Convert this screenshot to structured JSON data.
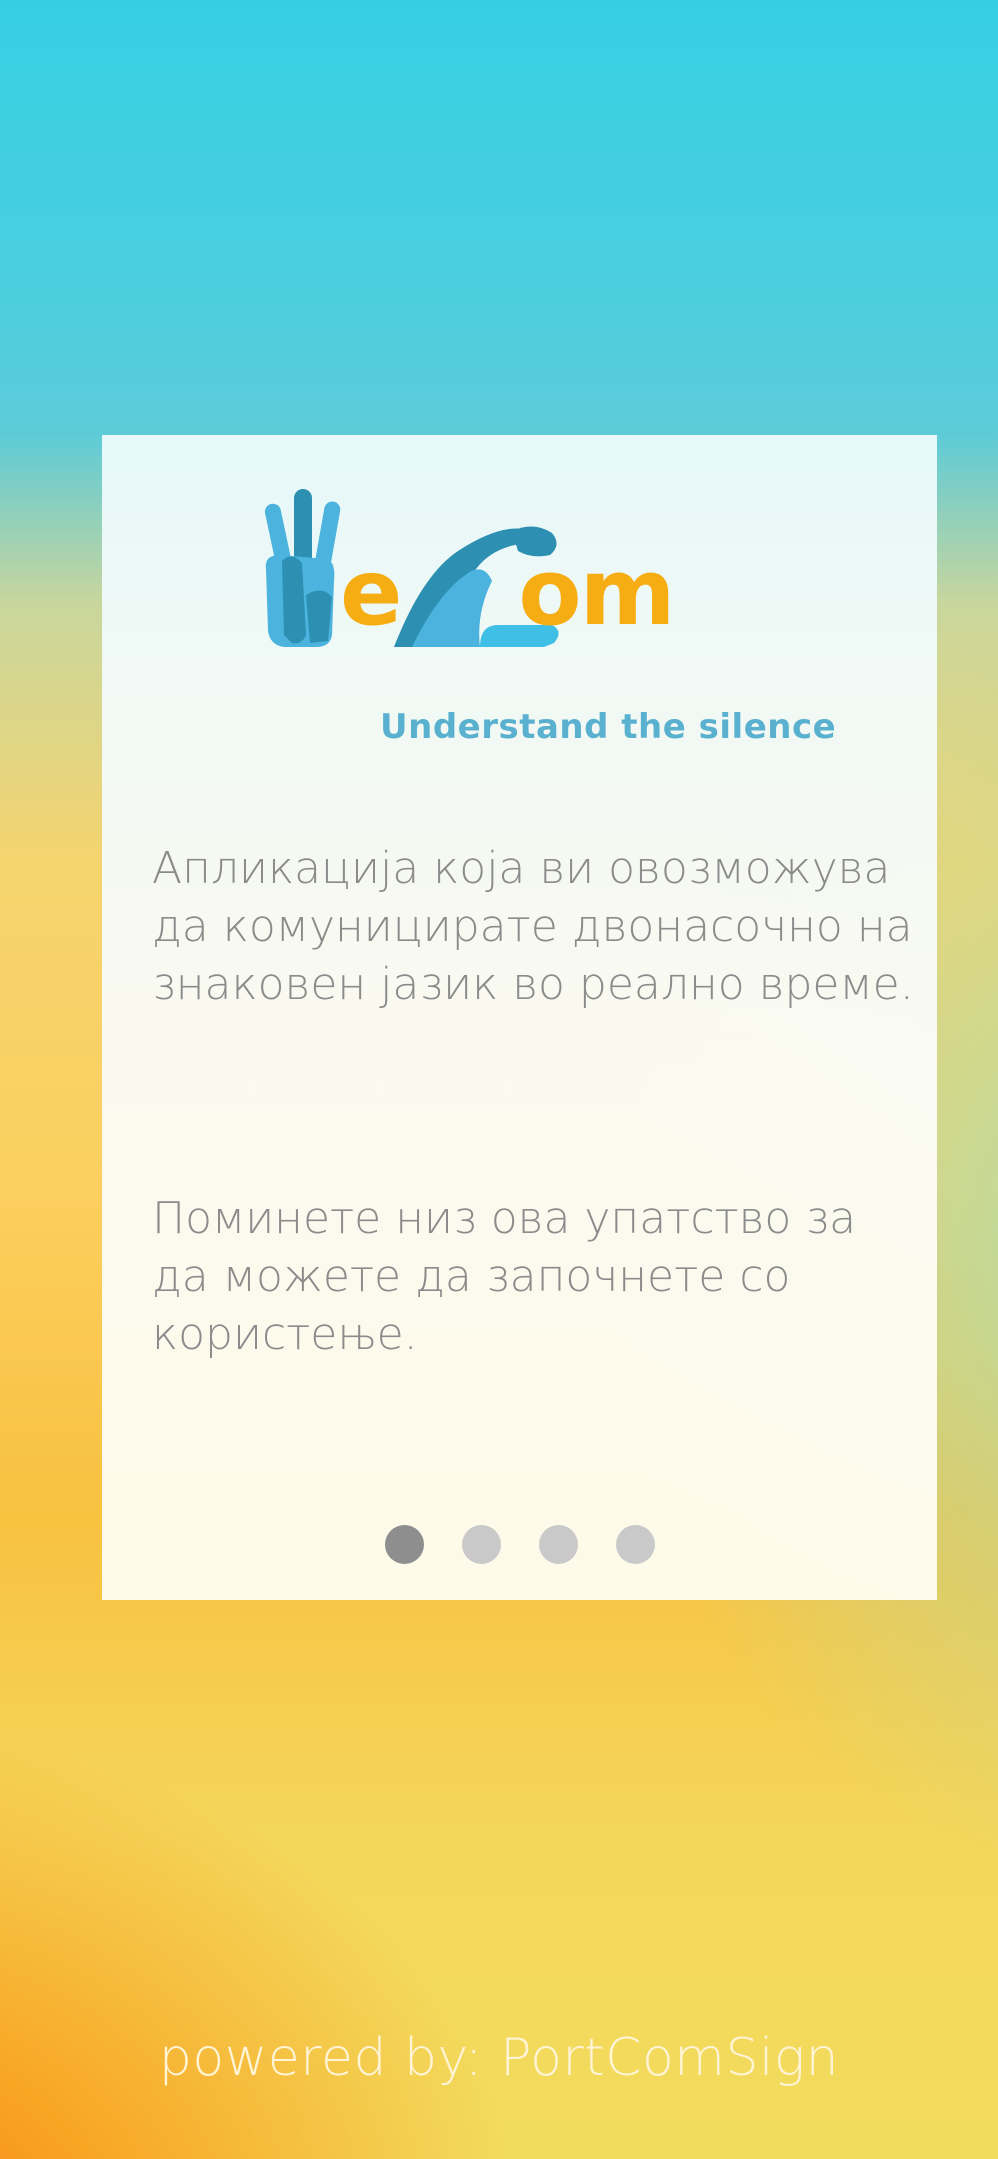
{
  "logo": {
    "wordmark_part1": "e",
    "wordmark_part2": "om",
    "tagline": "Understand the silence",
    "icons": [
      "hand-w-icon",
      "hand-c-icon"
    ],
    "colors": {
      "orange": "#f6ad14",
      "blue": "#4bb3dd",
      "dark_blue": "#2d8fb2",
      "tagline": "#5ab1cf"
    }
  },
  "intro": {
    "paragraph1": "Апликација која ви овозможува да комуницирате двонасочно на знаковен јазик во реално време.",
    "paragraph2": "Поминете низ ова упатство за да можете да започнете со користење."
  },
  "pager": {
    "total": 4,
    "active_index": 0
  },
  "footer": {
    "text": "powered by: PortComSign"
  }
}
